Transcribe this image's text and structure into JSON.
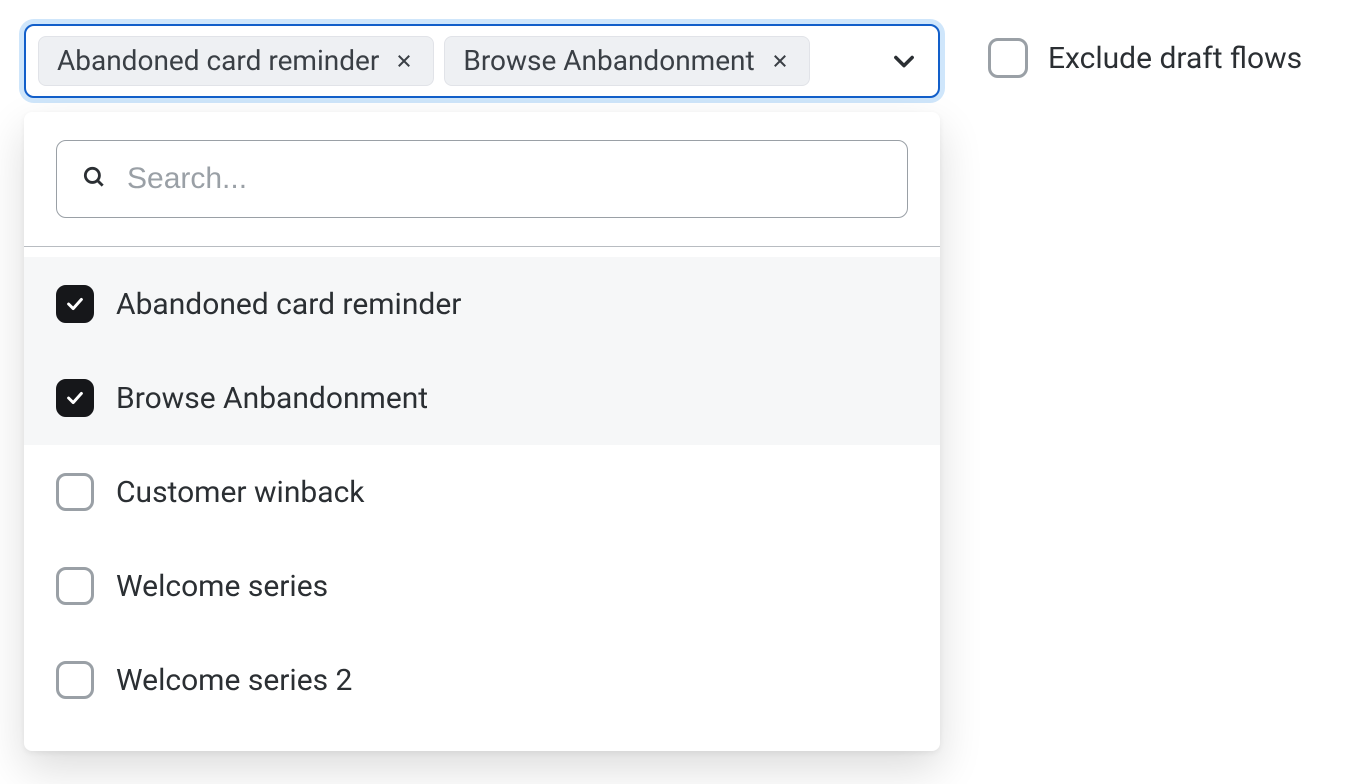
{
  "combobox": {
    "chips": [
      {
        "label": "Abandoned card reminder"
      },
      {
        "label": "Browse Anbandonment"
      }
    ]
  },
  "search": {
    "placeholder": "Search...",
    "value": ""
  },
  "options": [
    {
      "label": "Abandoned card reminder",
      "checked": true
    },
    {
      "label": "Browse Anbandonment",
      "checked": true
    },
    {
      "label": "Customer winback",
      "checked": false
    },
    {
      "label": "Welcome series",
      "checked": false
    },
    {
      "label": "Welcome series 2",
      "checked": false
    }
  ],
  "exclude": {
    "label": "Exclude draft flows",
    "checked": false
  }
}
